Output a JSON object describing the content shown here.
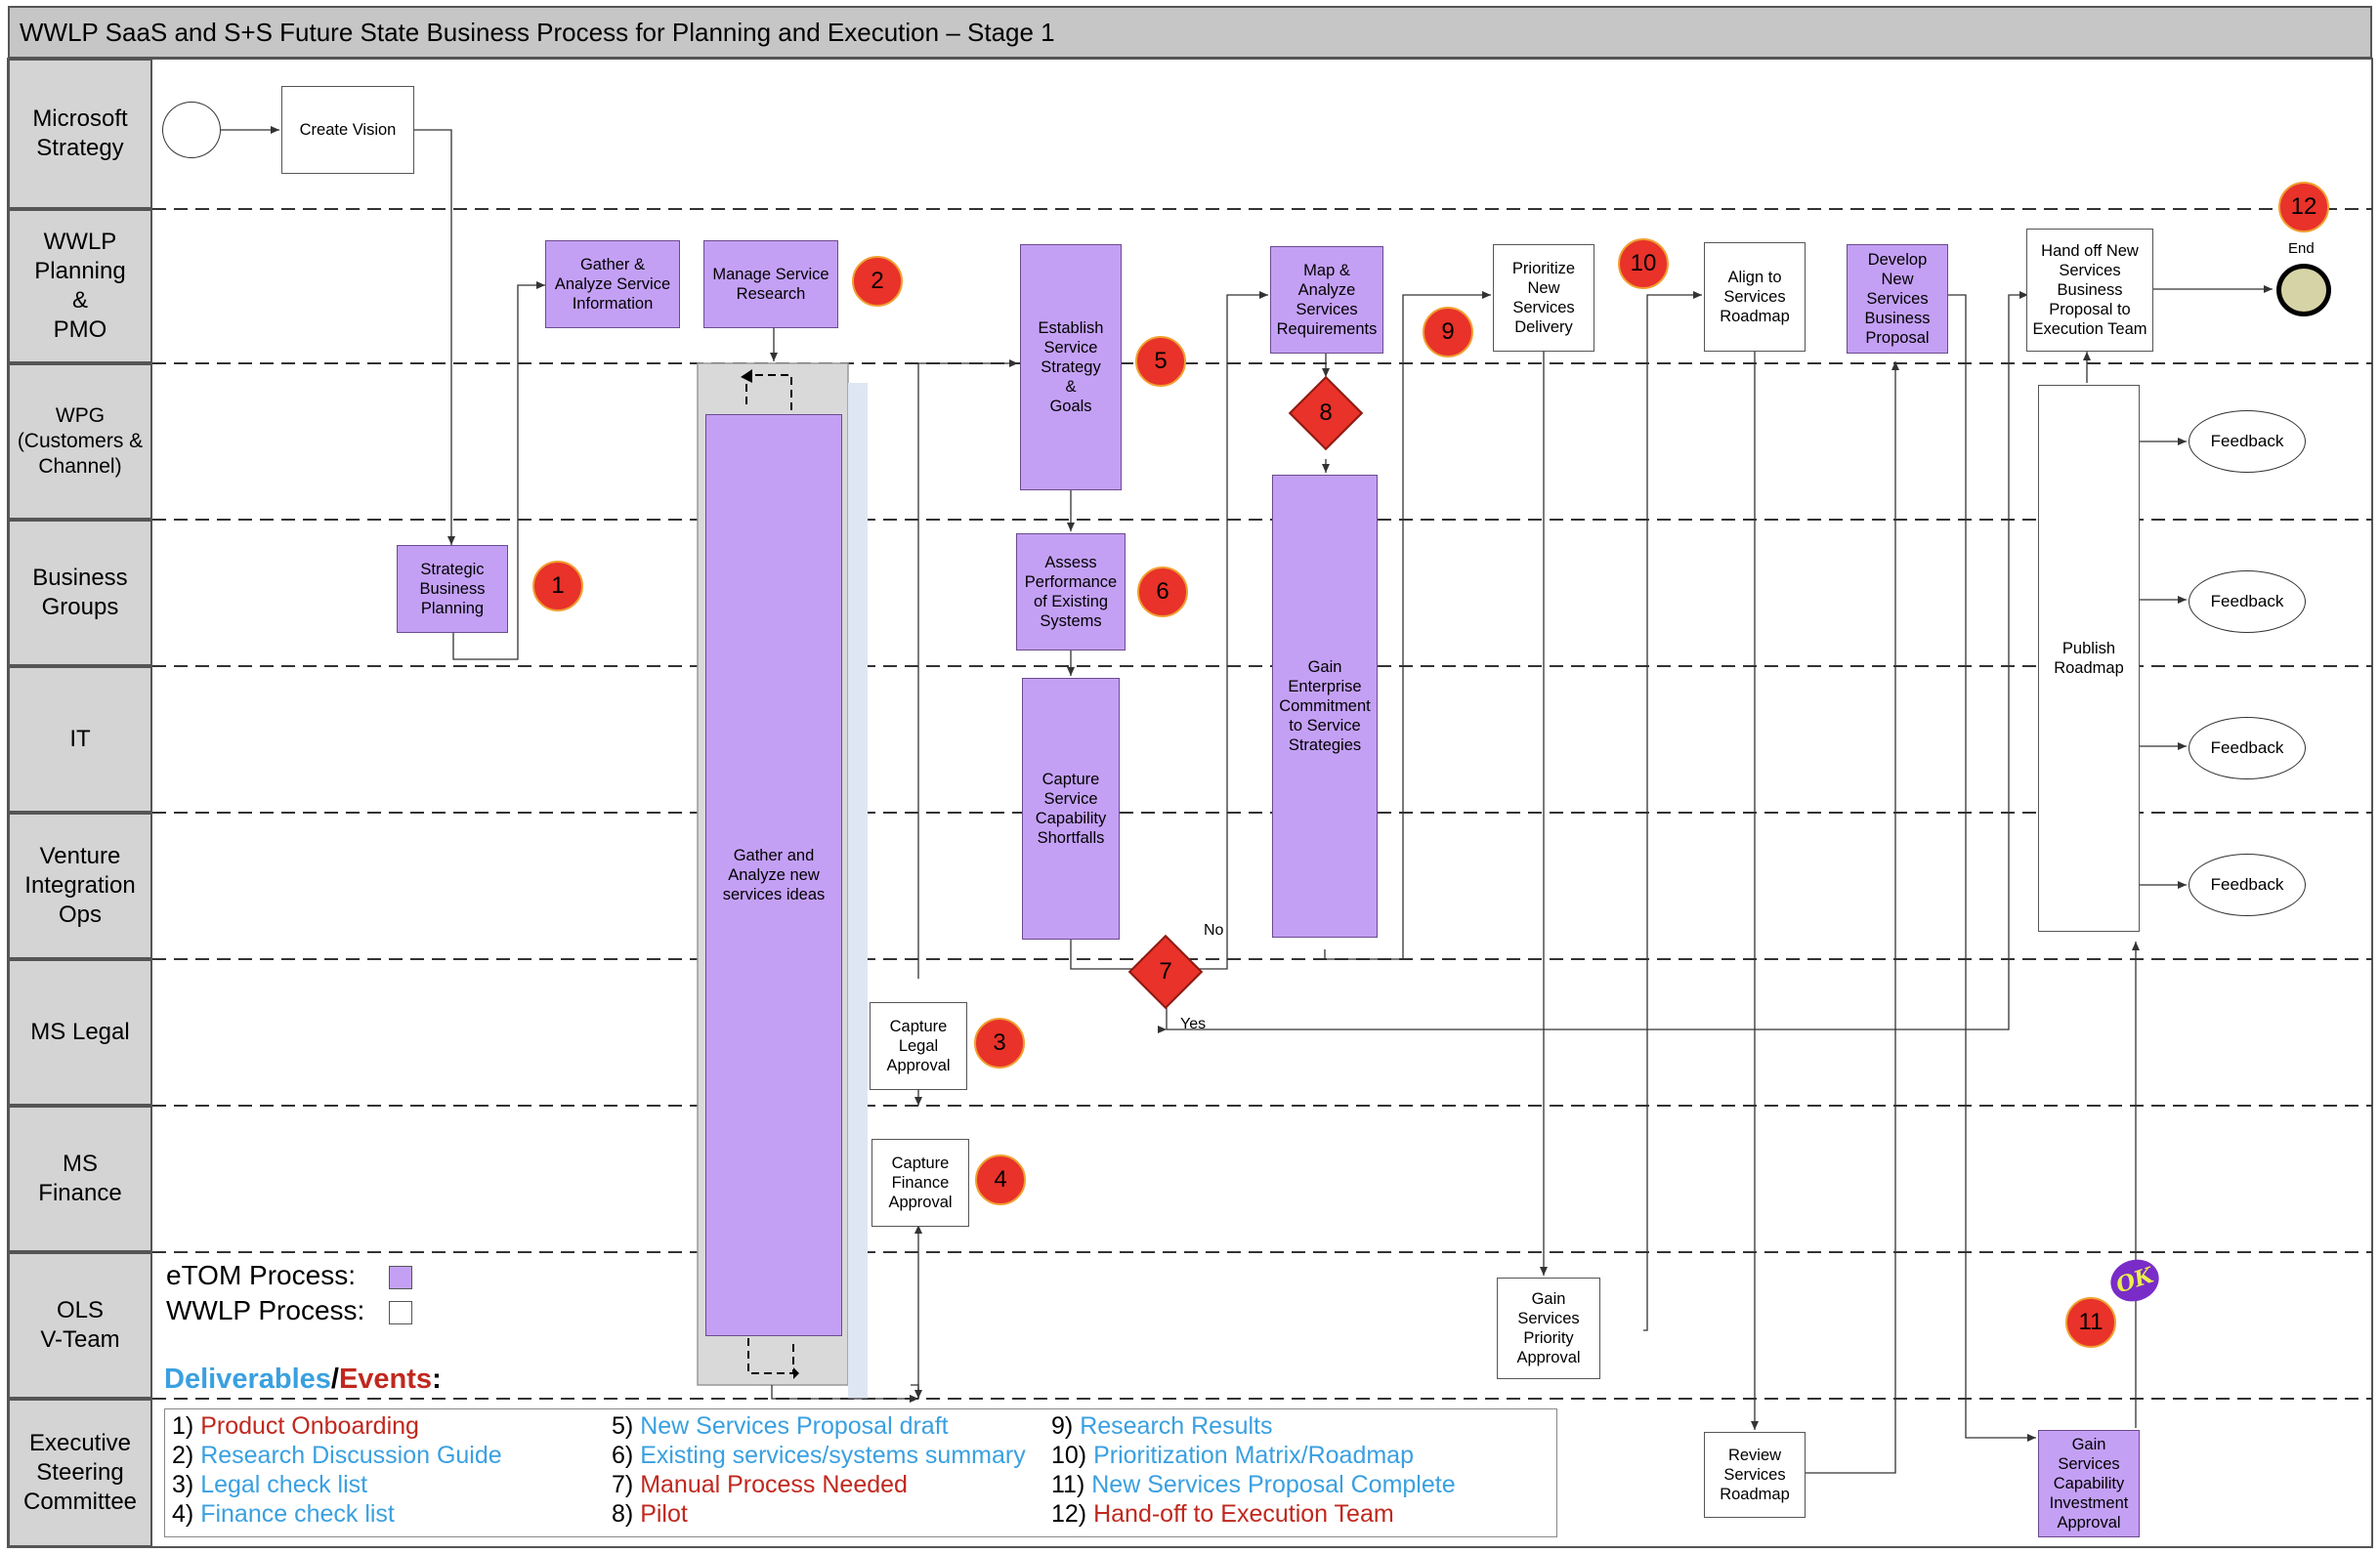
{
  "title": "WWLP SaaS and S+S Future State Business Process for Planning and Execution – Stage 1",
  "lanes": [
    {
      "label": "Microsoft\nStrategy"
    },
    {
      "label": "WWLP\nPlanning\n&\nPMO"
    },
    {
      "label": "WPG\n(Customers &\nChannel)"
    },
    {
      "label": "Business\nGroups"
    },
    {
      "label": "IT"
    },
    {
      "label": "Venture\nIntegration\nOps"
    },
    {
      "label": "MS Legal"
    },
    {
      "label": "MS\nFinance"
    },
    {
      "label": "OLS\nV-Team"
    },
    {
      "label": "Executive\nSteering\nCommittee"
    }
  ],
  "boxes": {
    "create_vision": "Create Vision",
    "gather_analyze_service_info": "Gather &\nAnalyze Service\nInformation",
    "manage_service_research": "Manage Service\nResearch",
    "strategic_business_planning": "Strategic\nBusiness\nPlanning",
    "gather_analyze_new_ideas": "Gather and\nAnalyze new\nservices ideas",
    "capture_legal_approval": "Capture\nLegal\nApproval",
    "capture_finance_approval": "Capture\nFinance\nApproval",
    "establish_service_strategy": "Establish\nService\nStrategy\n&\nGoals",
    "assess_performance": "Assess\nPerformance\nof Existing\nSystems",
    "capture_capability_shortfalls": "Capture\nService\nCapability\nShortfalls",
    "map_analyze_requirements": "Map &\nAnalyze\nServices\nRequirements",
    "gain_enterprise_commitment": "Gain\nEnterprise\nCommitment\nto Service\nStrategies",
    "prioritize_new_services": "Prioritize\nNew\nServices\nDelivery",
    "gain_priority_approval": "Gain\nServices\nPriority\nApproval",
    "align_roadmap": "Align to\nServices\nRoadmap",
    "review_roadmap": "Review\nServices\nRoadmap",
    "develop_business_proposal": "Develop\nNew\nServices\nBusiness\nProposal",
    "hand_off_proposal": "Hand off New\nServices\nBusiness\nProposal to\nExecution Team",
    "publish_roadmap": "Publish\nRoadmap",
    "gain_investment_approval": "Gain\nServices\nCapability\nInvestment\nApproval"
  },
  "feedback_label": "Feedback",
  "end_label": "End",
  "no_label": "No",
  "yes_label": "Yes",
  "ok_mark": "OK",
  "badges": [
    "1",
    "2",
    "3",
    "4",
    "5",
    "6",
    "7",
    "8",
    "9",
    "10",
    "11",
    "12"
  ],
  "legend": {
    "etom": "eTOM Process:",
    "wwlp": "WWLP Process:",
    "etom_color": "#c4a0f5",
    "wwlp_color": "#ffffff"
  },
  "deliverables_title": {
    "part1": "Deliverables",
    "sep": "/",
    "part2": "Events",
    "colon": ":"
  },
  "colors": {
    "deliverable": "#3aa0e0",
    "event": "#c0281e",
    "process_purple": "#c4a0f5",
    "badge_red": "#e8322a"
  },
  "deliverables": [
    {
      "num": "1)",
      "text": "Product Onboarding",
      "kind": "event"
    },
    {
      "num": "2)",
      "text": "Research Discussion Guide",
      "kind": "deliverable"
    },
    {
      "num": "3)",
      "text": "Legal check list",
      "kind": "deliverable"
    },
    {
      "num": "4)",
      "text": "Finance check list",
      "kind": "deliverable"
    },
    {
      "num": "5)",
      "text": "New Services Proposal draft",
      "kind": "deliverable"
    },
    {
      "num": "6)",
      "text": "Existing services/systems summary",
      "kind": "deliverable"
    },
    {
      "num": "7)",
      "text": "Manual Process Needed",
      "kind": "event"
    },
    {
      "num": "8)",
      "text": "Pilot",
      "kind": "event"
    },
    {
      "num": "9)",
      "text": "Research Results",
      "kind": "deliverable"
    },
    {
      "num": "10)",
      "text": "Prioritization Matrix/Roadmap",
      "kind": "deliverable"
    },
    {
      "num": "11)",
      "text": "New Services Proposal Complete",
      "kind": "deliverable"
    },
    {
      "num": "12)",
      "text": "Hand-off to Execution Team",
      "kind": "event"
    }
  ]
}
